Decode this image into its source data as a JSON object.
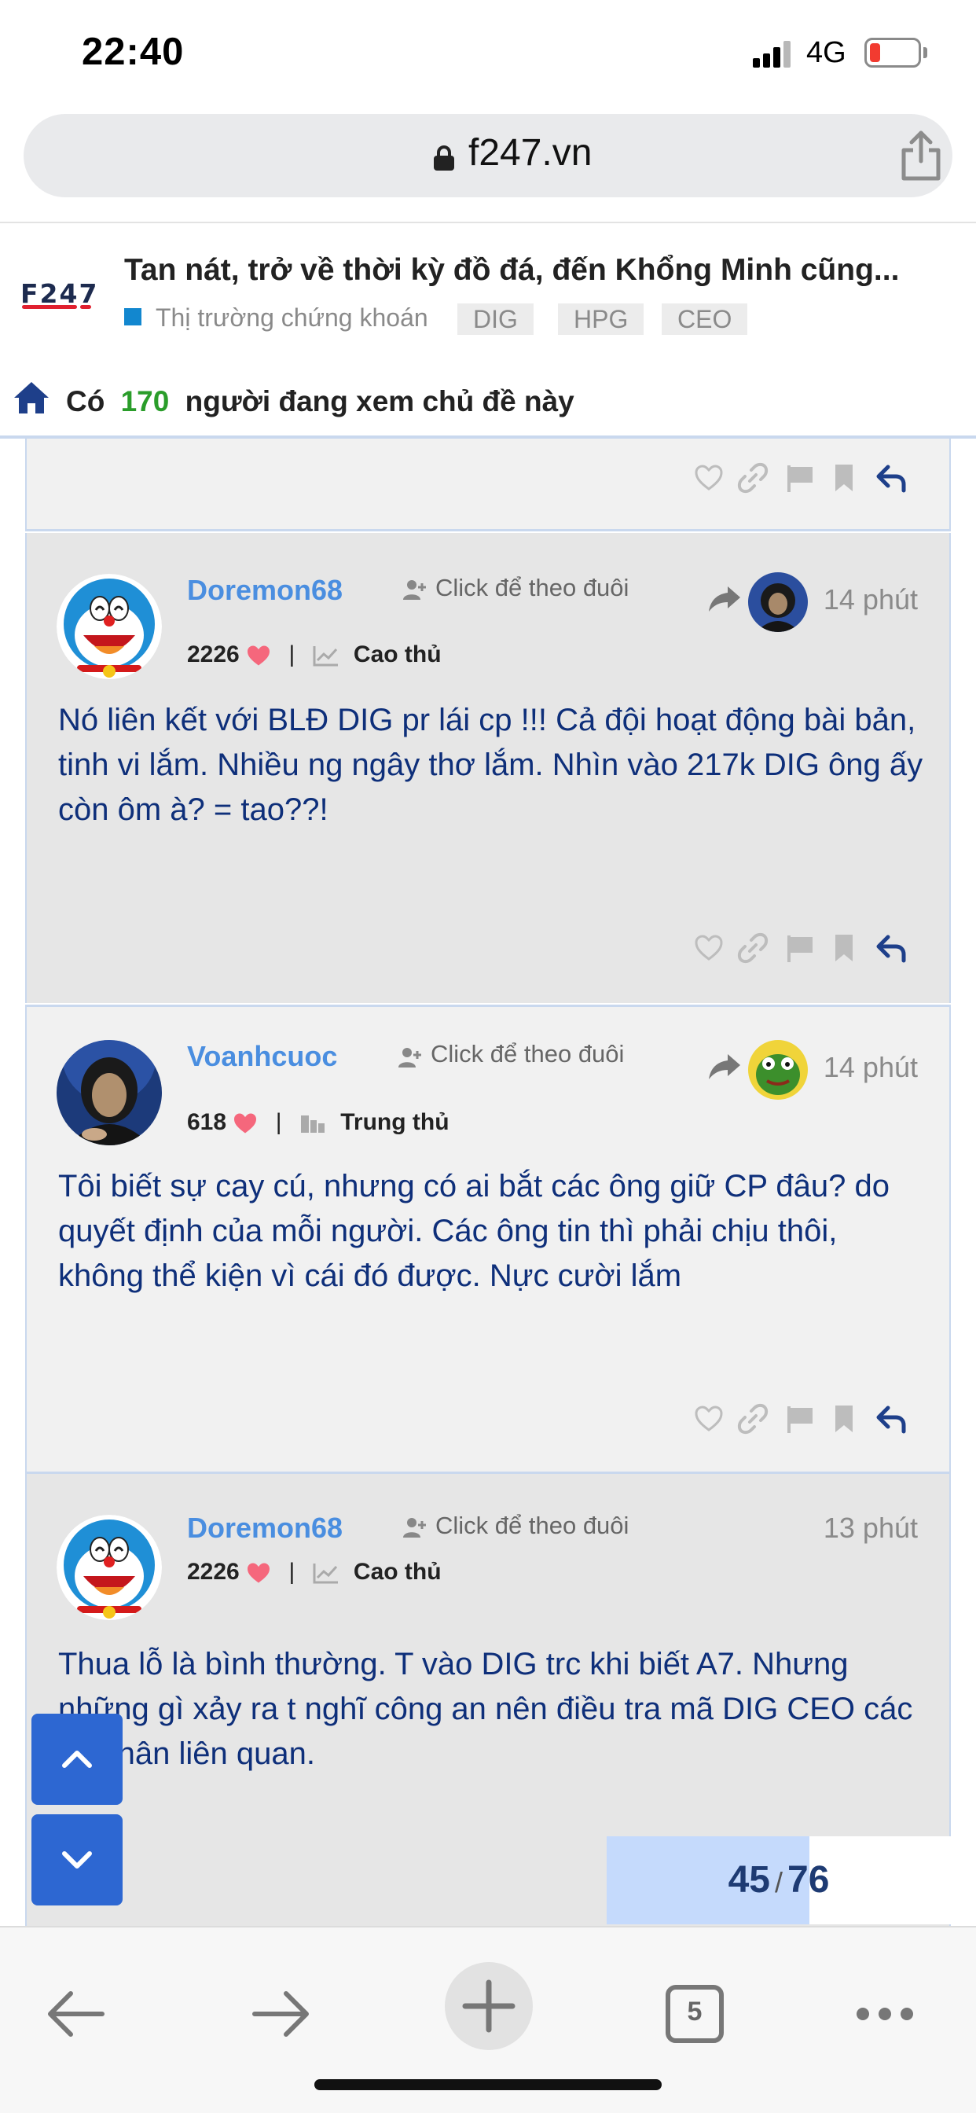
{
  "status": {
    "time": "22:40",
    "network": "4G"
  },
  "browser": {
    "url": "f247.vn",
    "tab_count": "5"
  },
  "thread": {
    "logo_text": "F247",
    "title": "Tan nát, trở về thời kỳ đồ đá, đến Khổng Minh cũng...",
    "category": "Thị trường chứng khoán",
    "tags": [
      "DIG",
      "HPG",
      "CEO"
    ],
    "viewer_prefix": "Có",
    "viewer_count": "170",
    "viewer_suffix": "người đang xem chủ đề này"
  },
  "posts": [
    {
      "username": "Doremon68",
      "follow_label": "Click để theo đuôi",
      "time": "14 phút",
      "likes": "2226",
      "rank": "Cao thủ",
      "body": "Nó liên kết với BLĐ DIG pr lái cp !!! Cả đội hoạt động bài bản, tinh vi lắm. Nhiều ng ngây thơ lắm. Nhìn vào 217k DIG ông ấy còn ôm à? = tao??!"
    },
    {
      "username": "Voanhcuoc",
      "follow_label": "Click để theo đuôi",
      "time": "14 phút",
      "likes": "618",
      "rank": "Trung thủ",
      "body": "Tôi biết sự cay cú, nhưng có ai bắt các ông giữ CP đâu? do quyết định của mỗi người. Các ông tin thì phải chịu thôi, không thể kiện vì cái đó được. Nực cười lắm"
    },
    {
      "username": "Doremon68",
      "follow_label": "Click để theo đuôi",
      "time": "13 phút",
      "likes": "2226",
      "rank": "Cao thủ",
      "body": "Thua lỗ là bình thường. T vào DIG trc khi biết A7. Nhưng những gì xảy ra t nghĩ công an nên điều tra mã DIG CEO các cá nhân liên quan."
    }
  ],
  "pagination": {
    "current": "45",
    "total": "76",
    "progress": 0.59
  },
  "colors": {
    "accent": "#2d67d2",
    "username": "#4a8ee0",
    "body_text": "#0e2f7a",
    "viewer_count": "#2a9d2a"
  }
}
